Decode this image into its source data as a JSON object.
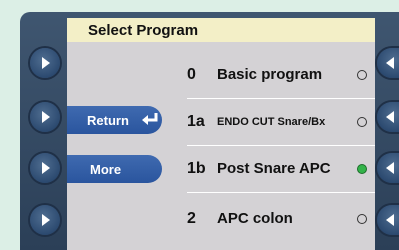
{
  "title": "Select Program",
  "softkeys": {
    "return_label": "Return",
    "more_label": "More"
  },
  "programs": [
    {
      "code": "0",
      "name": "Basic program",
      "selected": false
    },
    {
      "code": "1a",
      "name": "ENDO CUT Snare/Bx",
      "selected": false
    },
    {
      "code": "1b",
      "name": "Post Snare APC",
      "selected": true
    },
    {
      "code": "2",
      "name": "APC colon",
      "selected": false
    }
  ],
  "colors": {
    "frame": "#34495f",
    "screen": "#d4d2d5",
    "titlebar": "#f3efc7",
    "softkey": "#2f5ea8",
    "selected_indicator": "#33b34a"
  },
  "icons": {
    "return": "return-arrow-icon",
    "hardware_left": "triangle-right-icon",
    "hardware_right": "triangle-left-icon"
  }
}
